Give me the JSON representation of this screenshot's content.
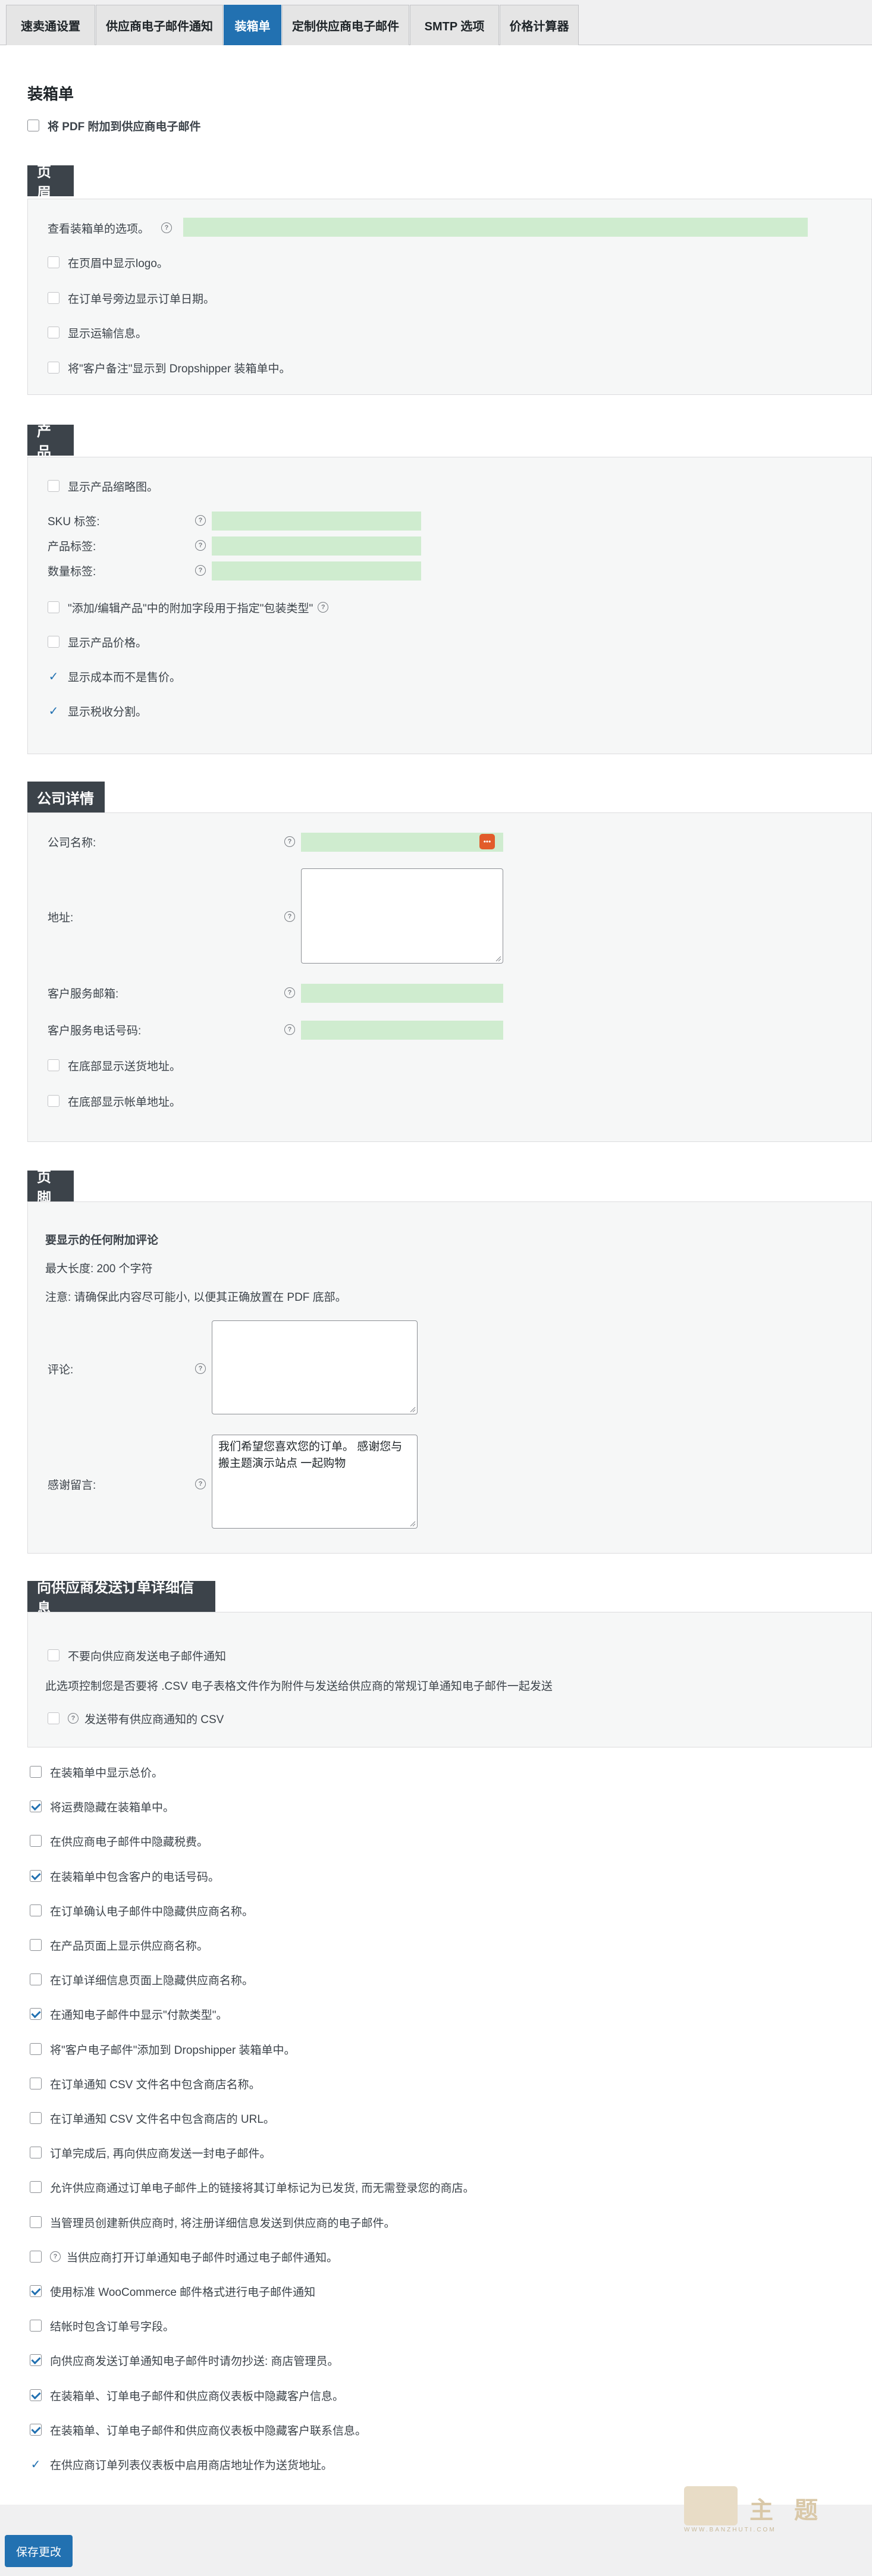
{
  "tabs": [
    "速卖通设置",
    "供应商电子邮件通知",
    "装箱单",
    "定制供应商电子邮件",
    "SMTP 选项",
    "价格计算器"
  ],
  "page": {
    "title": "装箱单",
    "attach_pdf": "将 PDF 附加到供应商电子邮件"
  },
  "header_section": {
    "title": "页眉",
    "options_label": "查看装箱单的选项。",
    "items": [
      "在页眉中显示logo。",
      "在订单号旁边显示订单日期。",
      "显示运输信息。",
      "将\"客户备注\"显示到 Dropshipper 装箱单中。"
    ]
  },
  "product_section": {
    "title": "产品",
    "show_thumb": "显示产品缩略图。",
    "sku_label": "SKU 标签:",
    "product_label": "产品标签:",
    "qty_label": "数量标签:",
    "extra_field": "\"添加/编辑产品\"中的附加字段用于指定\"包装类型\"",
    "show_price": "显示产品价格。",
    "cost_not_price": "显示成本而不是售价。",
    "tax_split": "显示税收分割。"
  },
  "company_section": {
    "title": "公司详情",
    "company_name": "公司名称:",
    "address": "地址:",
    "service_email": "客户服务邮箱:",
    "service_phone": "客户服务电话号码:",
    "footer_shipping": "在底部显示送货地址。",
    "footer_billing": "在底部显示帐单地址。",
    "dots_icon_text": "•••"
  },
  "footer_section": {
    "title": "页脚",
    "extra_comment": "要显示的任何附加评论",
    "max_len": "最大长度: 200 个字符",
    "note": "注意: 请确保此内容尽可能小, 以便其正确放置在 PDF 底部。",
    "comment_label": "评论:",
    "thanks_label": "感谢留言:",
    "thanks_value": "我们希望您喜欢您的订单。 感谢您与 搬主题演示站点 一起购物"
  },
  "order_section": {
    "title": "向供应商发送订单详细信息",
    "no_email": "不要向供应商发送电子邮件通知",
    "csv_desc": "此选项控制您是否要将 .CSV 电子表格文件作为附件与发送给供应商的常规订单通知电子邮件一起发送",
    "send_csv": "发送带有供应商通知的 CSV"
  },
  "settings": [
    {
      "label": "在装箱单中显示总价。",
      "checked": false
    },
    {
      "label": "将运费隐藏在装箱单中。",
      "checked": true
    },
    {
      "label": "在供应商电子邮件中隐藏税费。",
      "checked": false
    },
    {
      "label": "在装箱单中包含客户的电话号码。",
      "checked": true
    },
    {
      "label": "在订单确认电子邮件中隐藏供应商名称。",
      "checked": false
    },
    {
      "label": "在产品页面上显示供应商名称。",
      "checked": false
    },
    {
      "label": "在订单详细信息页面上隐藏供应商名称。",
      "checked": false
    },
    {
      "label": "在通知电子邮件中显示\"付款类型\"。",
      "checked": true
    },
    {
      "label": "将\"客户电子邮件\"添加到 Dropshipper 装箱单中。",
      "checked": false
    },
    {
      "label": "在订单通知 CSV 文件名中包含商店名称。",
      "checked": false
    },
    {
      "label": "在订单通知 CSV 文件名中包含商店的 URL。",
      "checked": false
    },
    {
      "label": "订单完成后, 再向供应商发送一封电子邮件。",
      "checked": false
    },
    {
      "label": "允许供应商通过订单电子邮件上的链接将其订单标记为已发货, 而无需登录您的商店。",
      "checked": false
    },
    {
      "label": "当管理员创建新供应商时, 将注册详细信息发送到供应商的电子邮件。",
      "checked": false
    },
    {
      "label": "当供应商打开订单通知电子邮件时通过电子邮件通知。",
      "checked": false
    },
    {
      "label": "使用标准 WooCommerce 邮件格式进行电子邮件通知",
      "checked": true
    },
    {
      "label": "结帐时包含订单号字段。",
      "checked": false
    },
    {
      "label": "向供应商发送订单通知电子邮件时请勿抄送: 商店管理员。",
      "checked": true
    },
    {
      "label": "在装箱单、订单电子邮件和供应商仪表板中隐藏客户信息。",
      "checked": true
    },
    {
      "label": "在装箱单、订单电子邮件和供应商仪表板中隐藏客户联系信息。",
      "checked": true
    },
    {
      "label": "在供应商订单列表仪表板中启用商店地址作为送货地址。",
      "checked": true
    }
  ],
  "save_button": "保存更改",
  "watermark_text": "主 题",
  "watermark_url": "WWW.BANZHUTI.COM",
  "colors": {
    "accent": "#2271b1",
    "section": "#3c434a",
    "field": "#cfeccf"
  }
}
